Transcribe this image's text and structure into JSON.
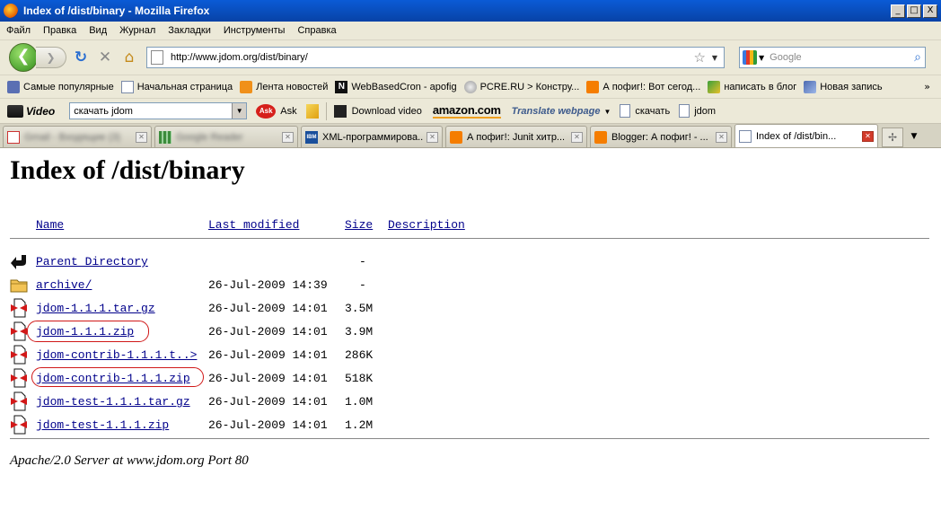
{
  "window": {
    "title": "Index of /dist/binary - Mozilla Firefox",
    "min": "_",
    "max": "□",
    "close": "X"
  },
  "menu": [
    "Файл",
    "Правка",
    "Вид",
    "Журнал",
    "Закладки",
    "Инструменты",
    "Справка"
  ],
  "nav": {
    "back_glyph": "❮",
    "fwd_glyph": "❯",
    "url": "http://www.jdom.org/dist/binary/",
    "search_placeholder": "Google"
  },
  "bookmarks": [
    {
      "label": "Самые популярные",
      "icon": "star-icon"
    },
    {
      "label": "Начальная страница",
      "icon": "page-icon"
    },
    {
      "label": "Лента новостей",
      "icon": "rss-icon"
    },
    {
      "label": "WebBasedCron - apofig",
      "icon": "n-icon"
    },
    {
      "label": "PCRE.RU > Констру...",
      "icon": "pcre-icon"
    },
    {
      "label": "А пофиг!: Вот сегод...",
      "icon": "blogger-icon"
    },
    {
      "label": "написать в блог",
      "icon": "pen-icon"
    },
    {
      "label": "Новая запись",
      "icon": "pencil-icon"
    }
  ],
  "bookmarks_more": "»",
  "toolbar2": {
    "video_label": "Video",
    "video_select": "скачать jdom",
    "ask_label": "Ask",
    "download_video": "Download video",
    "amazon": "amazon.com",
    "translate": "Translate webpage",
    "link1": "скачать",
    "link2": "jdom"
  },
  "tabs": [
    {
      "label": "Gmail - Входящие (3)",
      "blurred": true,
      "icon": "gmail-icon"
    },
    {
      "label": "Google Reader",
      "blurred": true,
      "icon": "grid-icon"
    },
    {
      "label": "XML-программирова...",
      "blurred": false,
      "icon": "ibm-icon"
    },
    {
      "label": "А пофиг!: Junit хитр...",
      "blurred": false,
      "icon": "blogger-icon"
    },
    {
      "label": "Blogger: А пофиг! - ...",
      "blurred": false,
      "icon": "blogger-icon"
    },
    {
      "label": "Index of /dist/bin...",
      "blurred": false,
      "icon": "page-icon",
      "active": true
    }
  ],
  "page": {
    "heading": "Index of /dist/binary",
    "columns": {
      "name": "Name",
      "modified": "Last modified",
      "size": "Size",
      "description": "Description"
    },
    "rows": [
      {
        "name": "Parent Directory",
        "date": "",
        "size": "-",
        "icon": "back-icon",
        "circled": false
      },
      {
        "name": "archive/",
        "date": "26-Jul-2009 14:39",
        "size": "-",
        "icon": "folder-icon",
        "circled": false
      },
      {
        "name": "jdom-1.1.1.tar.gz",
        "date": "26-Jul-2009 14:01",
        "size": "3.5M",
        "icon": "compressed-icon",
        "circled": false
      },
      {
        "name": "jdom-1.1.1.zip",
        "date": "26-Jul-2009 14:01",
        "size": "3.9M",
        "icon": "compressed-icon",
        "circled": true
      },
      {
        "name": "jdom-contrib-1.1.1.t..>",
        "date": "26-Jul-2009 14:01",
        "size": "286K",
        "icon": "compressed-icon",
        "circled": false
      },
      {
        "name": "jdom-contrib-1.1.1.zip",
        "date": "26-Jul-2009 14:01",
        "size": "518K",
        "icon": "compressed-icon",
        "circled": true
      },
      {
        "name": "jdom-test-1.1.1.tar.gz",
        "date": "26-Jul-2009 14:01",
        "size": "1.0M",
        "icon": "compressed-icon",
        "circled": false
      },
      {
        "name": "jdom-test-1.1.1.zip",
        "date": "26-Jul-2009 14:01",
        "size": "1.2M",
        "icon": "compressed-icon",
        "circled": false
      }
    ],
    "footer": "Apache/2.0 Server at www.jdom.org Port 80"
  }
}
